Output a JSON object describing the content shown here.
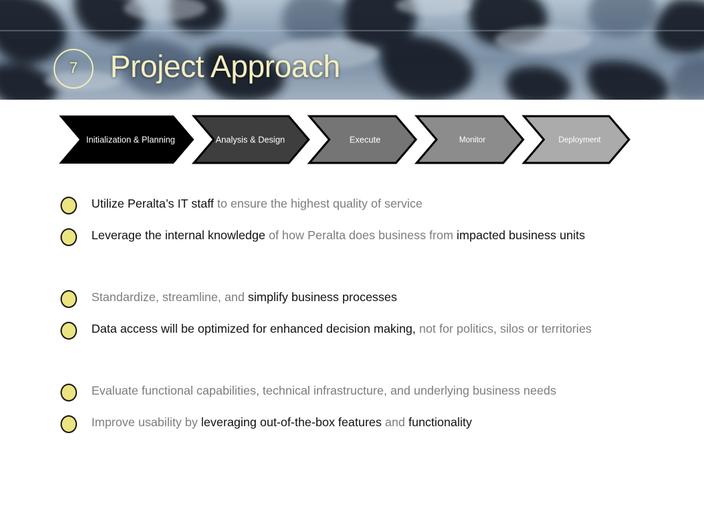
{
  "header": {
    "slide_number": "7",
    "title": "Project Approach",
    "title_color": "#f4eec0",
    "background": "blurred-jigsaw-puzzle-photo"
  },
  "process_bar": {
    "name": "project-phase-chevrons",
    "stages": [
      {
        "label": "Initialization & Planning",
        "color": "#000000"
      },
      {
        "label": "Analysis & Design",
        "color": "#3e3e3e"
      },
      {
        "label": "Execute",
        "color": "#757575"
      },
      {
        "label": "Monitor",
        "color": "#8c8c8c"
      },
      {
        "label": "Deployment",
        "color": "#ababab"
      }
    ]
  },
  "content": {
    "bullet_color": "#ece480",
    "groups": [
      {
        "bullets": [
          {
            "runs": [
              {
                "text": "Utilize Peralta’s IT staff ",
                "emphasis": true
              },
              {
                "text": "to ensure the highest quality of service",
                "emphasis": false
              }
            ]
          },
          {
            "runs": [
              {
                "text": "Leverage the internal knowledge ",
                "emphasis": true
              },
              {
                "text": "of how Peralta does business from ",
                "emphasis": false
              },
              {
                "text": "impacted business units",
                "emphasis": true
              }
            ]
          }
        ]
      },
      {
        "bullets": [
          {
            "runs": [
              {
                "text": "Standardize, streamline, and ",
                "emphasis": false
              },
              {
                "text": "simplify business processes",
                "emphasis": true
              }
            ]
          },
          {
            "runs": [
              {
                "text": "Data access will be optimized for enhanced decision making, ",
                "emphasis": true
              },
              {
                "text": "not for politics, silos or territories",
                "emphasis": false
              }
            ]
          }
        ]
      },
      {
        "bullets": [
          {
            "runs": [
              {
                "text": "Evaluate functional capabilities, technical infrastructure, and underlying business needs",
                "emphasis": false
              }
            ]
          },
          {
            "runs": [
              {
                "text": "Improve usability by ",
                "emphasis": false
              },
              {
                "text": "leveraging out-of-the-box features ",
                "emphasis": true
              },
              {
                "text": "and ",
                "emphasis": false
              },
              {
                "text": "functionality",
                "emphasis": true
              }
            ]
          }
        ]
      }
    ]
  }
}
